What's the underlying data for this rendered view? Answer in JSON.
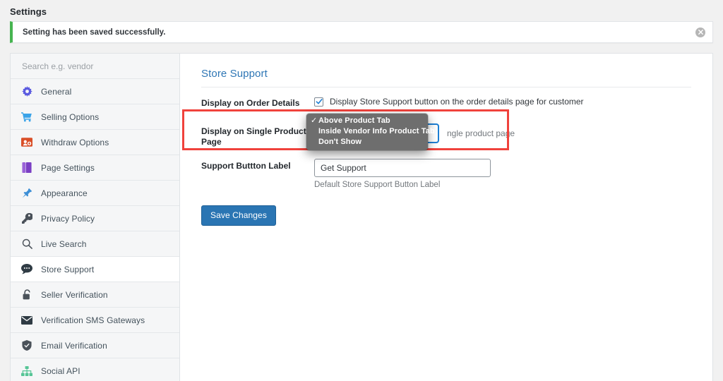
{
  "header": {
    "title": "Settings"
  },
  "notice": {
    "message": "Setting has been saved successfully.",
    "dismiss_icon": "close-circle-icon",
    "accent_color": "#46b450"
  },
  "sidebar": {
    "search": {
      "placeholder": "Search e.g. vendor",
      "value": ""
    },
    "items": [
      {
        "label": "General",
        "icon": "gear-icon",
        "color": "#5b5be0",
        "active": false
      },
      {
        "label": "Selling Options",
        "icon": "shopping-cart-icon",
        "color": "#3aa3e8",
        "active": false
      },
      {
        "label": "Withdraw Options",
        "icon": "withdraw-icon",
        "color": "#d94f28",
        "active": false
      },
      {
        "label": "Page Settings",
        "icon": "book-icon",
        "color": "#8e4fd0",
        "active": false
      },
      {
        "label": "Appearance",
        "icon": "pushpin-icon",
        "color": "#3d8fd6",
        "active": false
      },
      {
        "label": "Privacy Policy",
        "icon": "key-icon",
        "color": "#4a5159",
        "active": false
      },
      {
        "label": "Live Search",
        "icon": "search-icon",
        "color": "#4a5159",
        "active": false
      },
      {
        "label": "Store Support",
        "icon": "chat-bubble-icon",
        "color": "#2f3b44",
        "active": true
      },
      {
        "label": "Seller Verification",
        "icon": "lock-icon",
        "color": "#4a5159",
        "active": false
      },
      {
        "label": "Verification SMS Gateways",
        "icon": "envelope-icon",
        "color": "#2f3b44",
        "active": false
      },
      {
        "label": "Email Verification",
        "icon": "shield-icon",
        "color": "#4a5159",
        "active": false
      },
      {
        "label": "Social API",
        "icon": "sitemap-icon",
        "color": "#56c596",
        "active": false
      }
    ]
  },
  "main": {
    "section_title": "Store Support",
    "fields": {
      "order_details": {
        "label": "Display on Order Details",
        "checkbox_label": "Display Store Support button on the order details page for customer",
        "checked": true
      },
      "single_product": {
        "label": "Display on Single Product Page",
        "selected_value": "Above Product Tab",
        "help": "ngle product page",
        "options": [
          "Above Product Tab",
          "Inside Vendor Info Product Tab",
          "Don't Show"
        ]
      },
      "button_label": {
        "label": "Support Buttton Label",
        "value": "Get Support",
        "placeholder": "",
        "help": "Default Store Support Button Label"
      }
    },
    "save_label": "Save Changes",
    "accent_color": "#2a75b3",
    "highlight_color": "#f0423c"
  }
}
